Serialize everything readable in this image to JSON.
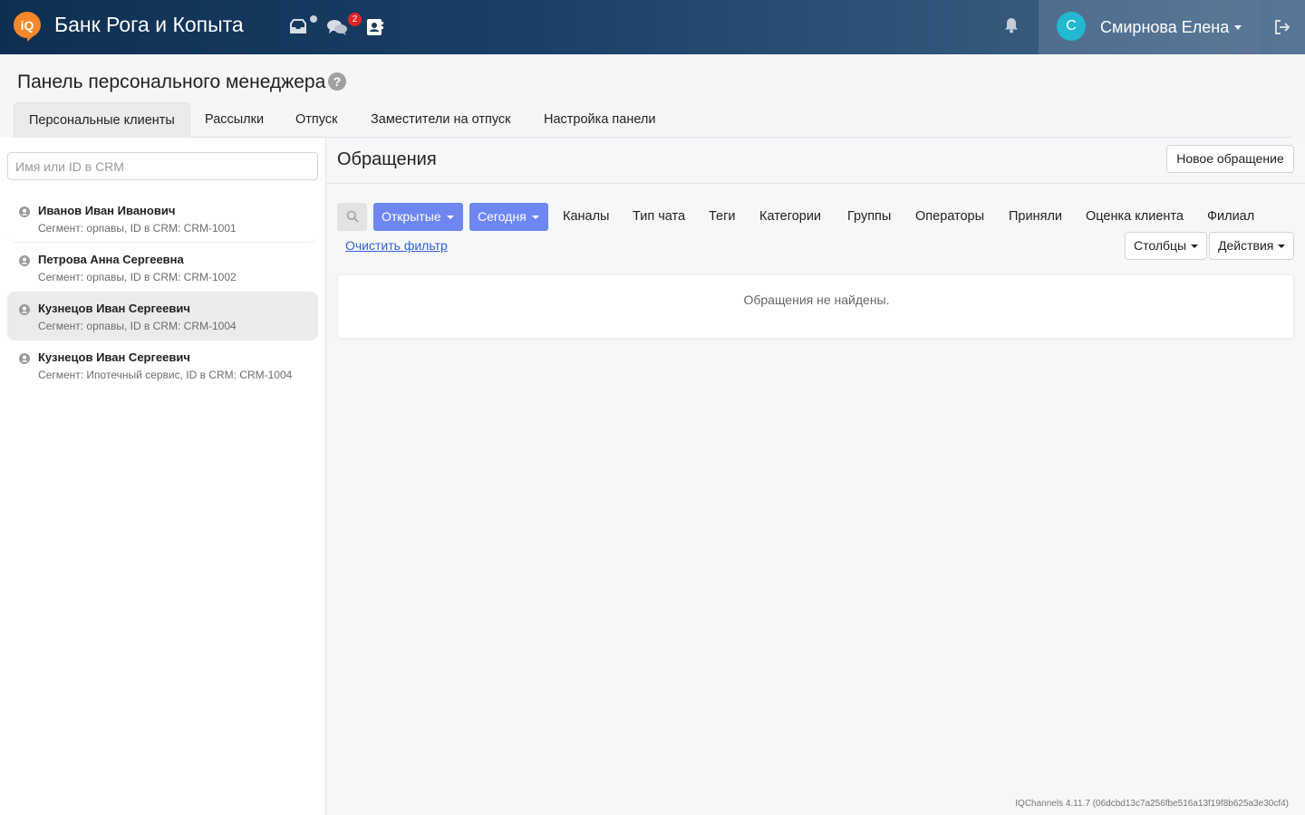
{
  "header": {
    "brand": "Банк Рога и Копыта",
    "chat_badge": "2",
    "user": {
      "initial": "С",
      "name": "Смирнова Елена"
    }
  },
  "page": {
    "title": "Панель персонального менеджера",
    "tabs": [
      {
        "label": "Персональные клиенты",
        "active": true
      },
      {
        "label": "Рассылки",
        "active": false
      },
      {
        "label": "Отпуск",
        "active": false
      },
      {
        "label": "Заместители на отпуск",
        "active": false
      },
      {
        "label": "Настройка панели",
        "active": false
      }
    ]
  },
  "sidebar": {
    "search_placeholder": "Имя или ID в CRM",
    "clients": [
      {
        "name": "Иванов Иван Иванович",
        "segment": "Сегмент: орпавы, ID в CRM: CRM-1001",
        "selected": false
      },
      {
        "name": "Петрова Анна Сергеевна",
        "segment": "Сегмент: орпавы, ID в CRM: CRM-1002",
        "selected": false
      },
      {
        "name": "Кузнецов Иван Сергеевич",
        "segment": "Сегмент: орпавы, ID в CRM: CRM-1004",
        "selected": true
      },
      {
        "name": "Кузнецов Иван Сергеевич",
        "segment": "Сегмент: Ипотечный сервис, ID в CRM: CRM-1004",
        "selected": false
      }
    ]
  },
  "main": {
    "title": "Обращения",
    "new_button": "Новое обращение",
    "filters": {
      "status": "Открытые",
      "period": "Сегодня",
      "items": [
        "Каналы",
        "Тип чата",
        "Теги",
        "Категории",
        "Группы",
        "Операторы",
        "Приняли",
        "Оценка клиента",
        "Филиал"
      ],
      "clear": "Очистить фильтр"
    },
    "columns_button": "Столбцы",
    "actions_button": "Действия",
    "empty_text": "Обращения не найдены."
  },
  "footer": {
    "version": "IQChannels 4.11.7 (06dcbd13c7a256fbe516a13f19f8b625a3e30cf4)"
  },
  "colors": {
    "accent": "#6e86f2",
    "header_dark": "#0e2f52",
    "badge": "#e02424",
    "avatar": "#22b8cf",
    "logo": "#f5872a"
  }
}
